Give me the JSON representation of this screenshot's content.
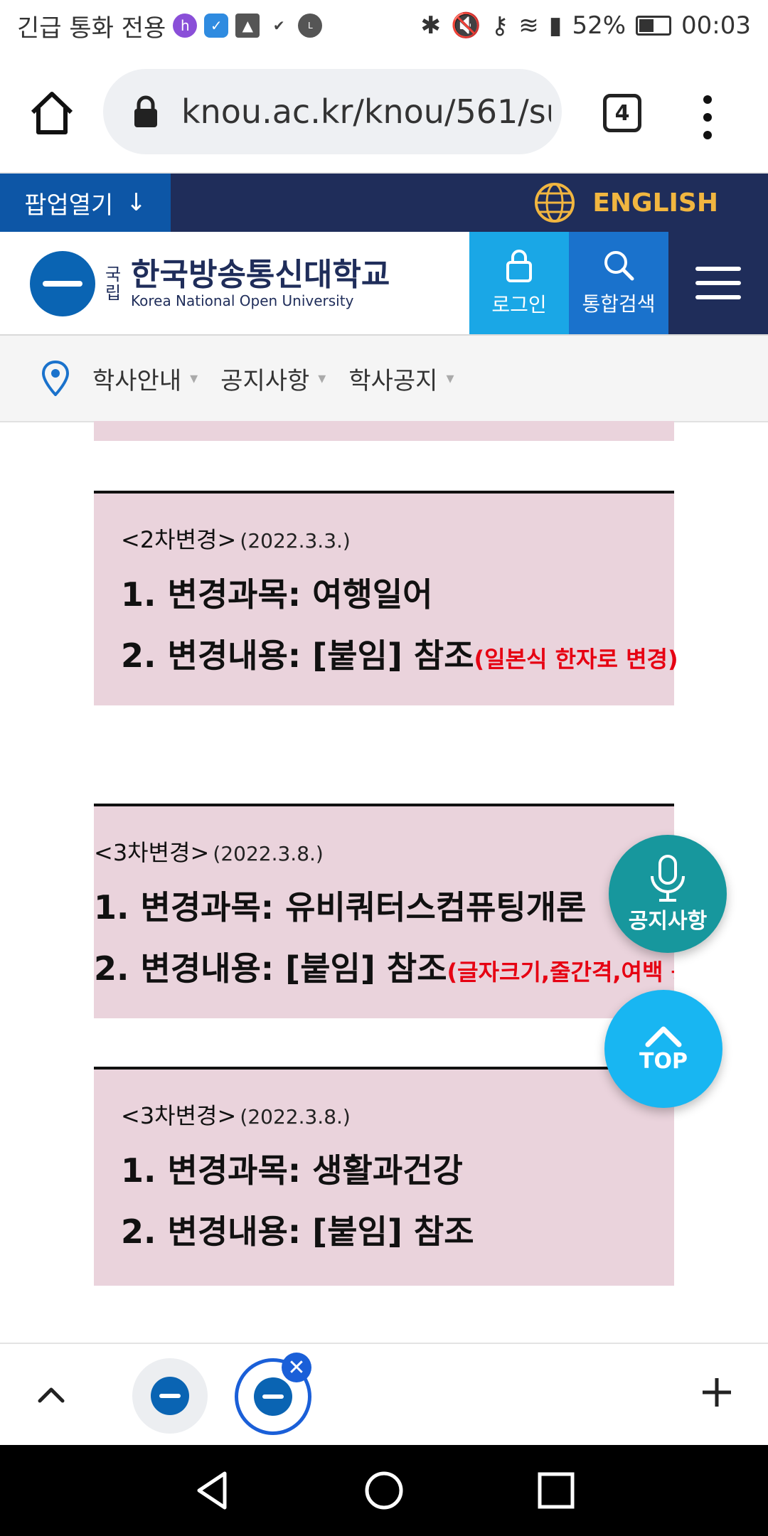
{
  "status_bar": {
    "carrier_text": "긴급 통화 전용",
    "battery": "52%",
    "time": "00:03"
  },
  "browser": {
    "url": "knou.ac.kr/knou/561/su",
    "tab_count": "4"
  },
  "site": {
    "popup_label": "팝업열기",
    "english_label": "ENGLISH",
    "logo_small": "국립",
    "logo_main": "한국방송통신대학교",
    "logo_eng": "Korea National Open University",
    "login_label": "로그인",
    "search_label": "통합검색"
  },
  "breadcrumb": {
    "items": [
      "학사안내",
      "공지사항",
      "학사공지"
    ]
  },
  "notices": [
    {
      "title": "<2차변경>",
      "date": "(2022.3.3.)",
      "line1": "1. 변경과목: 여행일어",
      "line2": "2. 변경내용: [붙임] 참조",
      "note": "(일본식 한자로 변경)"
    },
    {
      "title": "<3차변경>",
      "date": "(2022.3.8.)",
      "line1": "1. 변경과목: 유비쿼터스컴퓨팅개론",
      "line2": "2. 변경내용: [붙임] 참조",
      "note": "(글자크기,줄간격,여백 등"
    },
    {
      "title": "<3차변경>",
      "date": "(2022.3.8.)",
      "line1": "1. 변경과목: 생활과건강",
      "line2": "2. 변경내용: [붙임] 참조",
      "note": ""
    }
  ],
  "fab": {
    "notice_label": "공지사항",
    "top_label": "TOP"
  }
}
